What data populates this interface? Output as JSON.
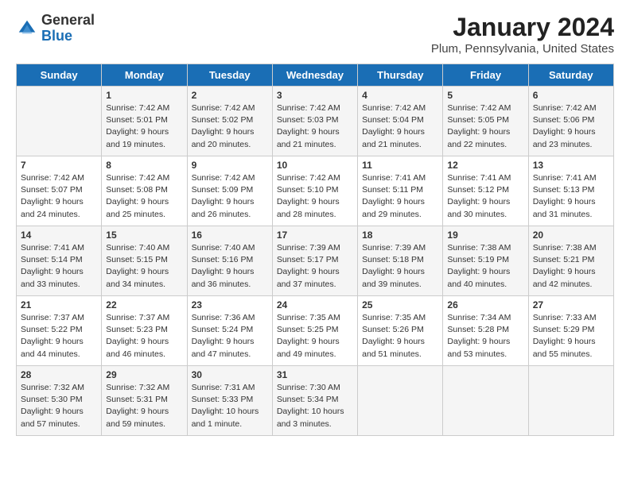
{
  "logo": {
    "general": "General",
    "blue": "Blue"
  },
  "header": {
    "title": "January 2024",
    "location": "Plum, Pennsylvania, United States"
  },
  "days_of_week": [
    "Sunday",
    "Monday",
    "Tuesday",
    "Wednesday",
    "Thursday",
    "Friday",
    "Saturday"
  ],
  "weeks": [
    [
      {
        "day": "",
        "sunrise": "",
        "sunset": "",
        "daylight": ""
      },
      {
        "day": "1",
        "sunrise": "Sunrise: 7:42 AM",
        "sunset": "Sunset: 5:01 PM",
        "daylight": "Daylight: 9 hours and 19 minutes."
      },
      {
        "day": "2",
        "sunrise": "Sunrise: 7:42 AM",
        "sunset": "Sunset: 5:02 PM",
        "daylight": "Daylight: 9 hours and 20 minutes."
      },
      {
        "day": "3",
        "sunrise": "Sunrise: 7:42 AM",
        "sunset": "Sunset: 5:03 PM",
        "daylight": "Daylight: 9 hours and 21 minutes."
      },
      {
        "day": "4",
        "sunrise": "Sunrise: 7:42 AM",
        "sunset": "Sunset: 5:04 PM",
        "daylight": "Daylight: 9 hours and 21 minutes."
      },
      {
        "day": "5",
        "sunrise": "Sunrise: 7:42 AM",
        "sunset": "Sunset: 5:05 PM",
        "daylight": "Daylight: 9 hours and 22 minutes."
      },
      {
        "day": "6",
        "sunrise": "Sunrise: 7:42 AM",
        "sunset": "Sunset: 5:06 PM",
        "daylight": "Daylight: 9 hours and 23 minutes."
      }
    ],
    [
      {
        "day": "7",
        "sunrise": "Sunrise: 7:42 AM",
        "sunset": "Sunset: 5:07 PM",
        "daylight": "Daylight: 9 hours and 24 minutes."
      },
      {
        "day": "8",
        "sunrise": "Sunrise: 7:42 AM",
        "sunset": "Sunset: 5:08 PM",
        "daylight": "Daylight: 9 hours and 25 minutes."
      },
      {
        "day": "9",
        "sunrise": "Sunrise: 7:42 AM",
        "sunset": "Sunset: 5:09 PM",
        "daylight": "Daylight: 9 hours and 26 minutes."
      },
      {
        "day": "10",
        "sunrise": "Sunrise: 7:42 AM",
        "sunset": "Sunset: 5:10 PM",
        "daylight": "Daylight: 9 hours and 28 minutes."
      },
      {
        "day": "11",
        "sunrise": "Sunrise: 7:41 AM",
        "sunset": "Sunset: 5:11 PM",
        "daylight": "Daylight: 9 hours and 29 minutes."
      },
      {
        "day": "12",
        "sunrise": "Sunrise: 7:41 AM",
        "sunset": "Sunset: 5:12 PM",
        "daylight": "Daylight: 9 hours and 30 minutes."
      },
      {
        "day": "13",
        "sunrise": "Sunrise: 7:41 AM",
        "sunset": "Sunset: 5:13 PM",
        "daylight": "Daylight: 9 hours and 31 minutes."
      }
    ],
    [
      {
        "day": "14",
        "sunrise": "Sunrise: 7:41 AM",
        "sunset": "Sunset: 5:14 PM",
        "daylight": "Daylight: 9 hours and 33 minutes."
      },
      {
        "day": "15",
        "sunrise": "Sunrise: 7:40 AM",
        "sunset": "Sunset: 5:15 PM",
        "daylight": "Daylight: 9 hours and 34 minutes."
      },
      {
        "day": "16",
        "sunrise": "Sunrise: 7:40 AM",
        "sunset": "Sunset: 5:16 PM",
        "daylight": "Daylight: 9 hours and 36 minutes."
      },
      {
        "day": "17",
        "sunrise": "Sunrise: 7:39 AM",
        "sunset": "Sunset: 5:17 PM",
        "daylight": "Daylight: 9 hours and 37 minutes."
      },
      {
        "day": "18",
        "sunrise": "Sunrise: 7:39 AM",
        "sunset": "Sunset: 5:18 PM",
        "daylight": "Daylight: 9 hours and 39 minutes."
      },
      {
        "day": "19",
        "sunrise": "Sunrise: 7:38 AM",
        "sunset": "Sunset: 5:19 PM",
        "daylight": "Daylight: 9 hours and 40 minutes."
      },
      {
        "day": "20",
        "sunrise": "Sunrise: 7:38 AM",
        "sunset": "Sunset: 5:21 PM",
        "daylight": "Daylight: 9 hours and 42 minutes."
      }
    ],
    [
      {
        "day": "21",
        "sunrise": "Sunrise: 7:37 AM",
        "sunset": "Sunset: 5:22 PM",
        "daylight": "Daylight: 9 hours and 44 minutes."
      },
      {
        "day": "22",
        "sunrise": "Sunrise: 7:37 AM",
        "sunset": "Sunset: 5:23 PM",
        "daylight": "Daylight: 9 hours and 46 minutes."
      },
      {
        "day": "23",
        "sunrise": "Sunrise: 7:36 AM",
        "sunset": "Sunset: 5:24 PM",
        "daylight": "Daylight: 9 hours and 47 minutes."
      },
      {
        "day": "24",
        "sunrise": "Sunrise: 7:35 AM",
        "sunset": "Sunset: 5:25 PM",
        "daylight": "Daylight: 9 hours and 49 minutes."
      },
      {
        "day": "25",
        "sunrise": "Sunrise: 7:35 AM",
        "sunset": "Sunset: 5:26 PM",
        "daylight": "Daylight: 9 hours and 51 minutes."
      },
      {
        "day": "26",
        "sunrise": "Sunrise: 7:34 AM",
        "sunset": "Sunset: 5:28 PM",
        "daylight": "Daylight: 9 hours and 53 minutes."
      },
      {
        "day": "27",
        "sunrise": "Sunrise: 7:33 AM",
        "sunset": "Sunset: 5:29 PM",
        "daylight": "Daylight: 9 hours and 55 minutes."
      }
    ],
    [
      {
        "day": "28",
        "sunrise": "Sunrise: 7:32 AM",
        "sunset": "Sunset: 5:30 PM",
        "daylight": "Daylight: 9 hours and 57 minutes."
      },
      {
        "day": "29",
        "sunrise": "Sunrise: 7:32 AM",
        "sunset": "Sunset: 5:31 PM",
        "daylight": "Daylight: 9 hours and 59 minutes."
      },
      {
        "day": "30",
        "sunrise": "Sunrise: 7:31 AM",
        "sunset": "Sunset: 5:33 PM",
        "daylight": "Daylight: 10 hours and 1 minute."
      },
      {
        "day": "31",
        "sunrise": "Sunrise: 7:30 AM",
        "sunset": "Sunset: 5:34 PM",
        "daylight": "Daylight: 10 hours and 3 minutes."
      },
      {
        "day": "",
        "sunrise": "",
        "sunset": "",
        "daylight": ""
      },
      {
        "day": "",
        "sunrise": "",
        "sunset": "",
        "daylight": ""
      },
      {
        "day": "",
        "sunrise": "",
        "sunset": "",
        "daylight": ""
      }
    ]
  ]
}
